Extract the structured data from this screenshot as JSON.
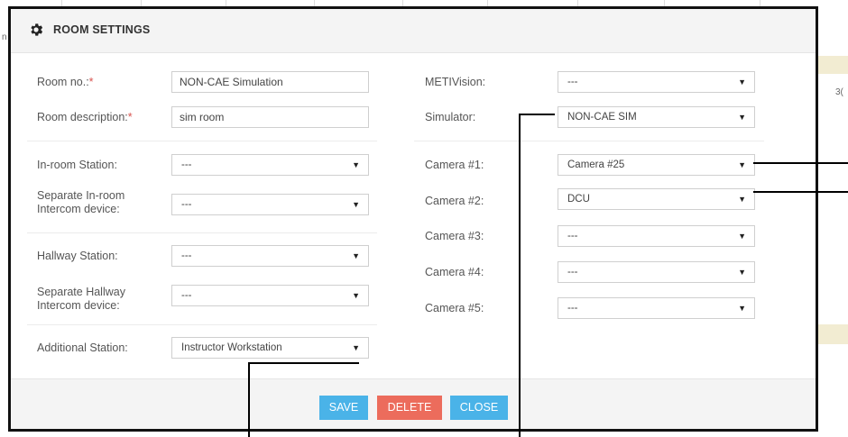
{
  "modal": {
    "title": "ROOM SETTINGS",
    "icon": "gear-icon"
  },
  "left_fields": {
    "room_no": {
      "label": "Room no.:",
      "required_mark": "*",
      "value": "NON-CAE Simulation"
    },
    "room_description": {
      "label": "Room description:",
      "required_mark": "*",
      "value": "sim room"
    },
    "in_room_station": {
      "label": "In-room Station:",
      "value": "---"
    },
    "separate_in_room_intercom": {
      "label_line1": "Separate In-room",
      "label_line2": "Intercom device:",
      "value": "---"
    },
    "hallway_station": {
      "label": "Hallway Station:",
      "value": "---"
    },
    "separate_hallway_intercom": {
      "label_line1": "Separate Hallway",
      "label_line2": "Intercom device:",
      "value": "---"
    },
    "additional_station": {
      "label": "Additional Station:",
      "value": "Instructor Workstation"
    }
  },
  "right_fields": {
    "metivision": {
      "label": "METIVision:",
      "value": "---"
    },
    "simulator": {
      "label": "Simulator:",
      "value": "NON-CAE SIM"
    },
    "camera1": {
      "label": "Camera #1:",
      "value": "Camera #25"
    },
    "camera2": {
      "label": "Camera #2:",
      "value": "DCU"
    },
    "camera3": {
      "label": "Camera #3:",
      "value": "---"
    },
    "camera4": {
      "label": "Camera #4:",
      "value": "---"
    },
    "camera5": {
      "label": "Camera #5:",
      "value": "---"
    }
  },
  "footer": {
    "save_label": "SAVE",
    "delete_label": "DELETE",
    "close_label": "CLOSE"
  },
  "colors": {
    "primary": "#4ab3e8",
    "danger": "#ec6c5c",
    "required": "#d9534f"
  },
  "background": {
    "edge_letter_left": "n",
    "edge_text_right": "3("
  }
}
